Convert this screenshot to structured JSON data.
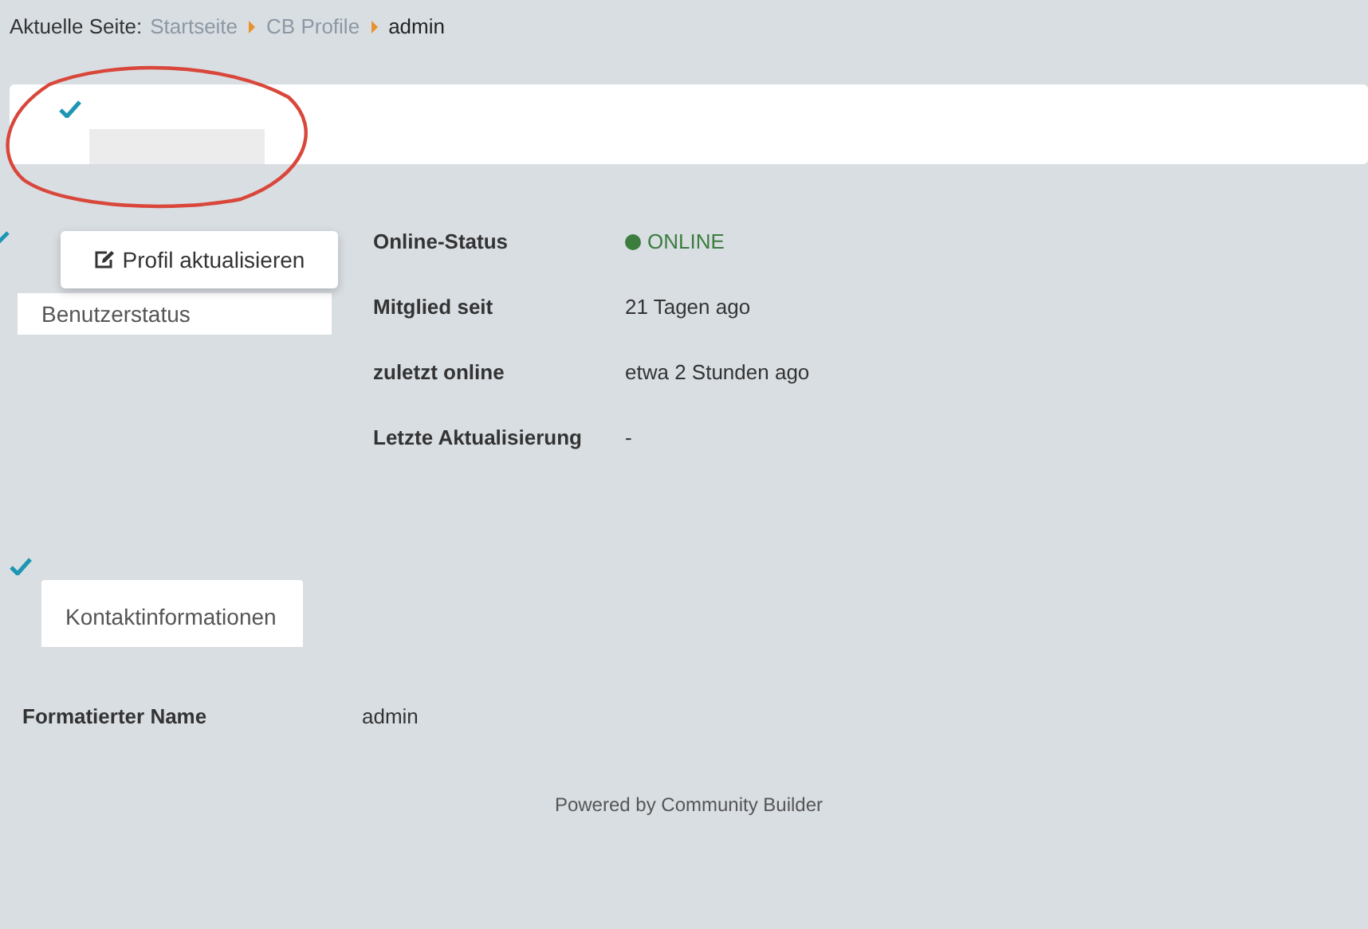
{
  "breadcrumb": {
    "label": "Aktuelle Seite:",
    "items": [
      {
        "text": "Startseite",
        "selected": false
      },
      {
        "text": "CB Profile",
        "selected": false
      },
      {
        "text": "admin",
        "selected": true
      }
    ]
  },
  "profile_button": {
    "label": "Profil aktualisieren"
  },
  "status_section": {
    "tab": "Benutzerstatus",
    "fields": [
      {
        "label": "Online-Status",
        "value": "ONLINE",
        "kind": "status",
        "color": "#3c7d3e"
      },
      {
        "label": "Mitglied seit",
        "value": "21 Tagen ago",
        "kind": "text"
      },
      {
        "label": "zuletzt online",
        "value": "etwa 2 Stunden ago",
        "kind": "text"
      },
      {
        "label": "Letzte Aktualisierung",
        "value": "-",
        "kind": "text"
      }
    ]
  },
  "contact_section": {
    "tab": "Kontaktinformationen",
    "fields": [
      {
        "label": "Formatierter Name",
        "value": "admin"
      }
    ]
  },
  "footer": "Powered by Community Builder"
}
